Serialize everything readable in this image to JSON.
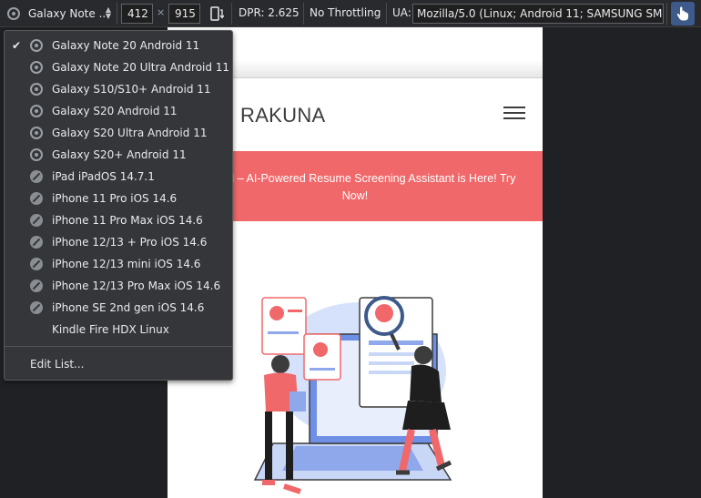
{
  "toolbar": {
    "device_label": "Galaxy Note ...",
    "width": "412",
    "times": "×",
    "height": "915",
    "dpr": "DPR: 2.625",
    "throttling": "No Throttling",
    "ua_label": "UA:",
    "ua_value": "Mozilla/5.0 (Linux; Android 11; SAMSUNG SM-"
  },
  "device_menu": {
    "selected": "Galaxy Note 20 Android 11",
    "items": [
      {
        "label": "Galaxy Note 20 Android 11",
        "checked": true,
        "icon": "chrome-icon"
      },
      {
        "label": "Galaxy Note 20 Ultra Android 11",
        "checked": false,
        "icon": "chrome-icon"
      },
      {
        "label": "Galaxy S10/S10+ Android 11",
        "checked": false,
        "icon": "chrome-icon"
      },
      {
        "label": "Galaxy S20 Android 11",
        "checked": false,
        "icon": "chrome-icon"
      },
      {
        "label": "Galaxy S20 Ultra Android 11",
        "checked": false,
        "icon": "chrome-icon"
      },
      {
        "label": "Galaxy S20+ Android 11",
        "checked": false,
        "icon": "chrome-icon"
      },
      {
        "label": "iPad iPadOS 14.7.1",
        "checked": false,
        "icon": "safari-icon"
      },
      {
        "label": "iPhone 11 Pro iOS 14.6",
        "checked": false,
        "icon": "safari-icon"
      },
      {
        "label": "iPhone 11 Pro Max iOS 14.6",
        "checked": false,
        "icon": "safari-icon"
      },
      {
        "label": "iPhone 12/13 + Pro iOS 14.6",
        "checked": false,
        "icon": "safari-icon"
      },
      {
        "label": "iPhone 12/13 mini iOS 14.6",
        "checked": false,
        "icon": "safari-icon"
      },
      {
        "label": "iPhone 12/13 Pro Max iOS 14.6",
        "checked": false,
        "icon": "safari-icon"
      },
      {
        "label": "iPhone SE 2nd gen iOS 14.6",
        "checked": false,
        "icon": "safari-icon"
      },
      {
        "label": "Kindle Fire HDX Linux",
        "checked": false,
        "icon": ""
      }
    ],
    "edit_label": "Edit List..."
  },
  "site": {
    "logo": "RAKUNA",
    "banner_line1": "CREEN – AI-Powered Resume Screening Assistant is Here! Try",
    "banner_line2": "Now!"
  },
  "colors": {
    "banner": "#f0686a",
    "accent_blue": "#3d5a8a"
  }
}
